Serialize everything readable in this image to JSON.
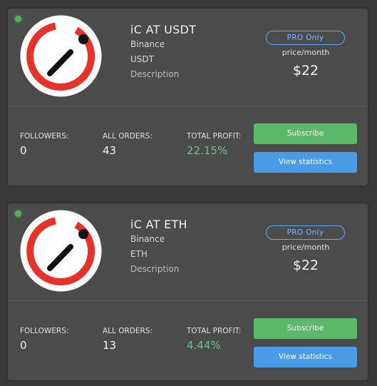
{
  "colors": {
    "logo_red": "#e5322a",
    "profit_green": "#6cc08a",
    "subscribe_green": "#5cb96a",
    "stats_blue": "#4a9be6",
    "badge_blue": "#5aa9ff",
    "online_green": "#4fb34f"
  },
  "strategies": [
    {
      "name": "iC AT USDT",
      "exchange": "Binance",
      "currency": "USDT",
      "description": "Description",
      "badge": "PRO Only",
      "price_label": "price/month",
      "price": "$22",
      "followers_label": "FOLLOWERS:",
      "followers": "0",
      "orders_label": "ALL ORDERS:",
      "orders": "43",
      "profit_label": "TOTAL PROFIT:",
      "profit": "22.15%",
      "subscribe_label": "Subscribe",
      "stats_label": "View statistics",
      "status_icon": "online-dot"
    },
    {
      "name": "iC AT ETH",
      "exchange": "Binance",
      "currency": "ETH",
      "description": "Description",
      "badge": "PRO Only",
      "price_label": "price/month",
      "price": "$22",
      "followers_label": "FOLLOWERS:",
      "followers": "0",
      "orders_label": "ALL ORDERS:",
      "orders": "13",
      "profit_label": "TOTAL PROFIT:",
      "profit": "4.44%",
      "subscribe_label": "Subscribe",
      "stats_label": "View statistics",
      "status_icon": "online-dot"
    }
  ]
}
